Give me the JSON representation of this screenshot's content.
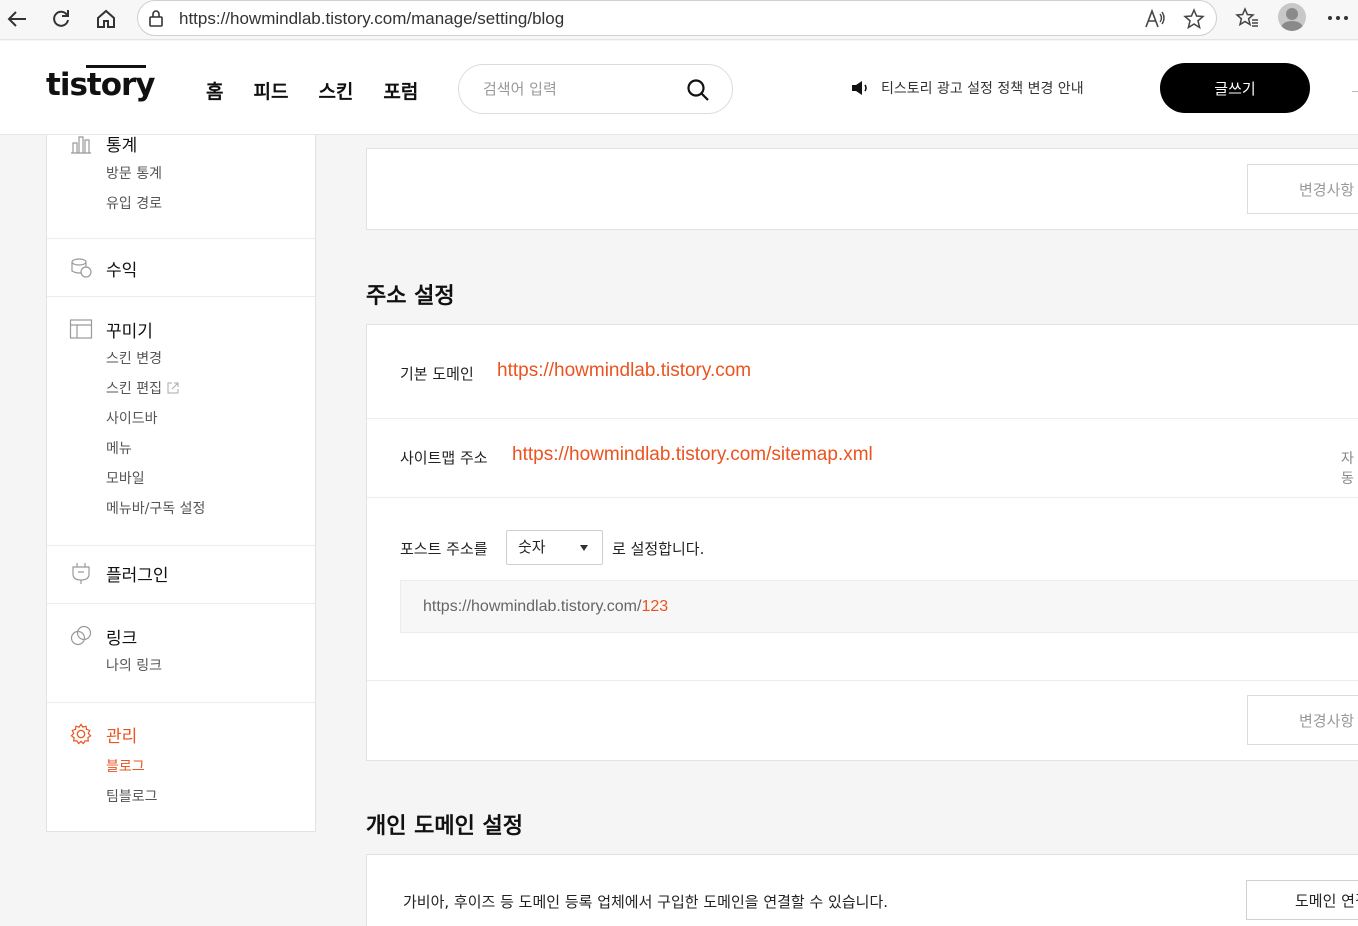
{
  "browser": {
    "url": "https://howmindlab.tistory.com/manage/setting/blog"
  },
  "header": {
    "logo": "tistory",
    "nav": [
      "홈",
      "피드",
      "스킨",
      "포럼"
    ],
    "search_placeholder": "검색어 입력",
    "notice": "티스토리 광고 설정 정책 변경 안내",
    "write_label": "글쓰기"
  },
  "sidebar": {
    "groups": [
      {
        "title": "통계",
        "icon": "chart-icon",
        "items": [
          "방문 통계",
          "유입 경로"
        ]
      },
      {
        "title": "수익",
        "icon": "coins-icon",
        "items": []
      },
      {
        "title": "꾸미기",
        "icon": "layout-icon",
        "items": [
          "스킨 변경",
          "스킨 편집",
          "사이드바",
          "메뉴",
          "모바일",
          "메뉴바/구독 설정"
        ]
      },
      {
        "title": "플러그인",
        "icon": "plug-icon",
        "items": []
      },
      {
        "title": "링크",
        "icon": "link-icon",
        "items": [
          "나의 링크"
        ]
      },
      {
        "title": "관리",
        "icon": "gear-icon",
        "items": [
          "블로그",
          "팀블로그"
        ]
      }
    ]
  },
  "main": {
    "save_label": "변경사항",
    "address_section": {
      "title": "주소 설정",
      "default_domain_label": "기본 도메인",
      "default_domain_value": "https://howmindlab.tistory.com",
      "sitemap_label": "사이트맵 주소",
      "sitemap_value": "https://howmindlab.tistory.com/sitemap.xml",
      "sitemap_right": "자동",
      "post_prefix": "포스트 주소를",
      "post_select": "숫자",
      "post_suffix": "로 설정합니다.",
      "preview_base": "https://howmindlab.tistory.com/",
      "preview_num": "123"
    },
    "domain_section": {
      "title": "개인 도메인 설정",
      "description": "가비아, 후이즈 등 도메인 등록 업체에서 구입한 도메인을 연결할 수 있습니다.",
      "connect_label": "도메인 연결"
    }
  },
  "colors": {
    "accent": "#eb531f",
    "write_button": "#000000"
  }
}
